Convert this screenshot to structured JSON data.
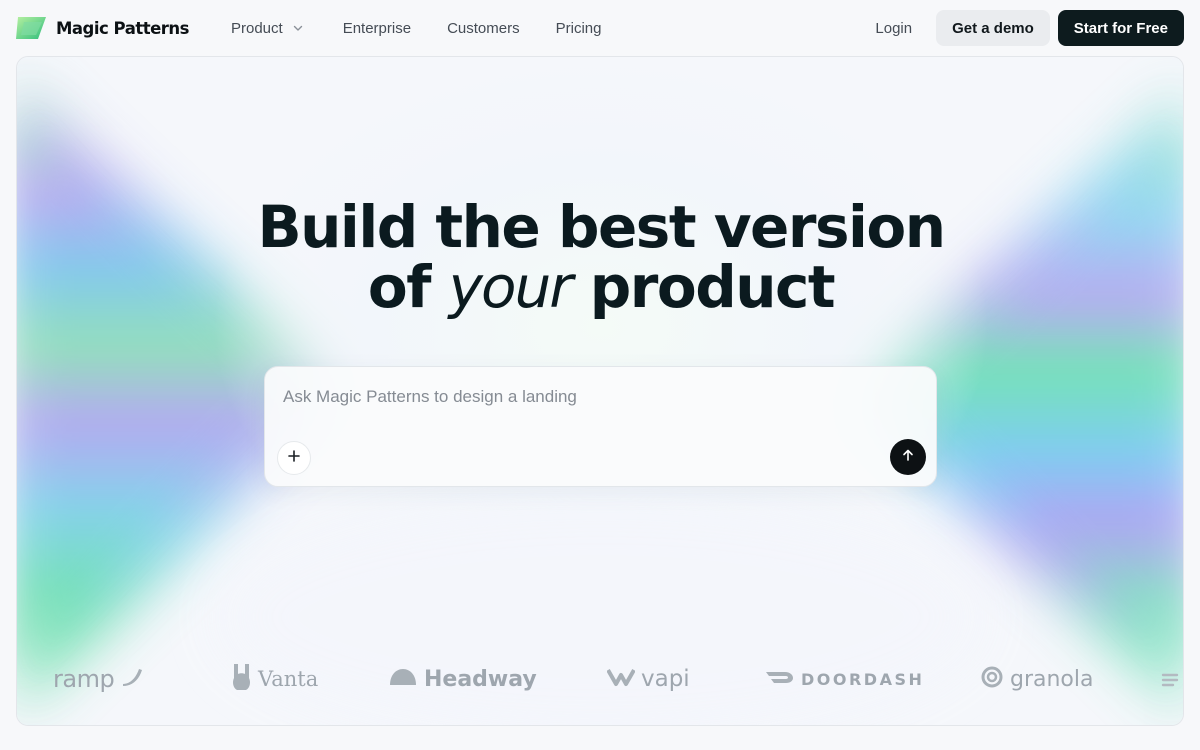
{
  "brand": {
    "name": "Magic Patterns",
    "logo_icon": "magic-patterns-logo-icon"
  },
  "nav": {
    "links": [
      {
        "label": "Product",
        "has_dropdown": true
      },
      {
        "label": "Enterprise",
        "has_dropdown": false
      },
      {
        "label": "Customers",
        "has_dropdown": false
      },
      {
        "label": "Pricing",
        "has_dropdown": false
      }
    ],
    "login_label": "Login",
    "demo_label": "Get a demo",
    "start_label": "Start for Free"
  },
  "hero": {
    "headline_line1": "Build the best version",
    "headline_line2_pre": "of",
    "headline_line2_em": "your",
    "headline_line2_post": "product"
  },
  "prompt": {
    "placeholder": "Ask Magic Patterns to design a landing",
    "value": "",
    "add_icon": "plus-icon",
    "send_icon": "arrow-up-icon"
  },
  "customers": {
    "logos": [
      "ramp",
      "Vanta",
      "Headway",
      "vapi",
      "DOORDASH",
      "granola"
    ]
  },
  "colors": {
    "primary_dark": "#0d1b1e",
    "demo_bg": "#eaecef",
    "text_muted": "#454c55",
    "logo_gray": "#9ea6ae"
  }
}
